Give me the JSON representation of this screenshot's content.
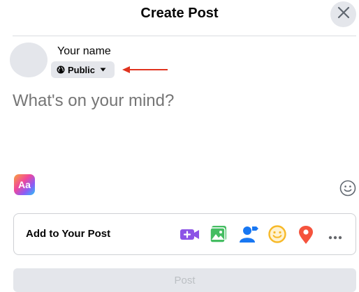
{
  "dialog": {
    "title": "Create Post",
    "close_icon": "close-icon"
  },
  "user": {
    "name": "Your name",
    "privacy": {
      "label": "Public",
      "icon": "globe-icon",
      "caret_icon": "caret-down-icon"
    },
    "annotation_arrow_color": "#e0331f"
  },
  "composer": {
    "placeholder": "What's on your mind?"
  },
  "background_button": {
    "label": "Aa"
  },
  "emoji_icon": "smiley-outline-icon",
  "add_to_post": {
    "label": "Add to Your Post",
    "icons": [
      {
        "name": "live-video-icon",
        "color": "#8c54e6"
      },
      {
        "name": "photo-video-icon",
        "color": "#45bd62"
      },
      {
        "name": "tag-people-icon",
        "color": "#1877f2"
      },
      {
        "name": "feeling-activity-icon",
        "color": "#f7b928"
      },
      {
        "name": "check-in-icon",
        "color": "#f5533d"
      },
      {
        "name": "more-icon",
        "color": "#65676b"
      }
    ]
  },
  "post_button": {
    "label": "Post"
  },
  "colors": {
    "text_primary": "#050505",
    "text_placeholder": "#8a8d91",
    "button_gray": "#e4e6eb",
    "disabled_text": "#bcc0c4"
  }
}
